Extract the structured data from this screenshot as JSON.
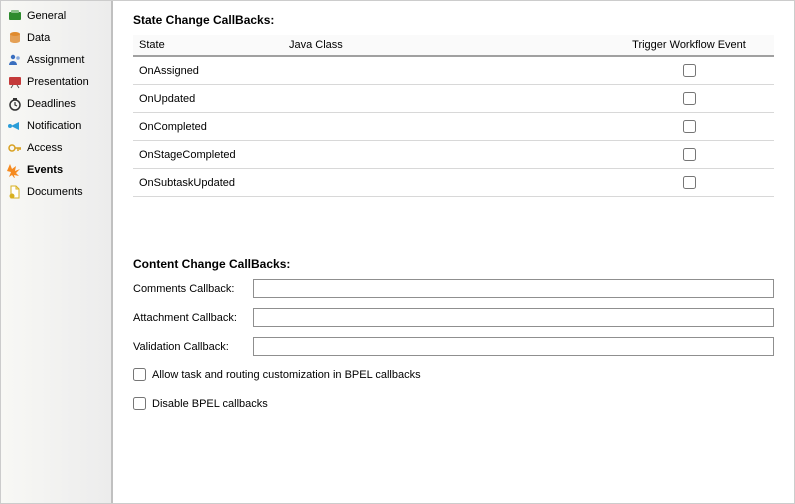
{
  "sidebar": {
    "items": [
      {
        "key": "general",
        "label": "General",
        "iconColor": "#2e8b2e",
        "active": false
      },
      {
        "key": "data",
        "label": "Data",
        "iconColor": "#e08b2e",
        "active": false
      },
      {
        "key": "assignment",
        "label": "Assignment",
        "iconColor": "#3a6fbf",
        "active": false
      },
      {
        "key": "presentation",
        "label": "Presentation",
        "iconColor": "#c43a3a",
        "active": false
      },
      {
        "key": "deadlines",
        "label": "Deadlines",
        "iconColor": "#333333",
        "active": false
      },
      {
        "key": "notification",
        "label": "Notification",
        "iconColor": "#2a9dd8",
        "active": false
      },
      {
        "key": "access",
        "label": "Access",
        "iconColor": "#d8a020",
        "active": false
      },
      {
        "key": "events",
        "label": "Events",
        "iconColor": "#f58a1f",
        "active": true
      },
      {
        "key": "documents",
        "label": "Documents",
        "iconColor": "#d8b020",
        "active": false
      }
    ]
  },
  "stateChange": {
    "title": "State Change CallBacks:",
    "headers": {
      "state": "State",
      "javaClass": "Java Class",
      "trigger": "Trigger Workflow Event"
    },
    "rows": [
      {
        "state": "OnAssigned",
        "javaClass": "",
        "trigger": false
      },
      {
        "state": "OnUpdated",
        "javaClass": "",
        "trigger": false
      },
      {
        "state": "OnCompleted",
        "javaClass": "",
        "trigger": false
      },
      {
        "state": "OnStageCompleted",
        "javaClass": "",
        "trigger": false
      },
      {
        "state": "OnSubtaskUpdated",
        "javaClass": "",
        "trigger": false
      }
    ]
  },
  "contentChange": {
    "title": "Content Change CallBacks:",
    "fields": {
      "comments": {
        "label": "Comments Callback:",
        "value": ""
      },
      "attachment": {
        "label": "Attachment Callback:",
        "value": ""
      },
      "validation": {
        "label": "Validation Callback:",
        "value": ""
      }
    }
  },
  "options": {
    "allowCustomization": {
      "label": "Allow task and routing customization in BPEL callbacks",
      "checked": false
    },
    "disableBpel": {
      "label": "Disable BPEL callbacks",
      "checked": false
    }
  }
}
